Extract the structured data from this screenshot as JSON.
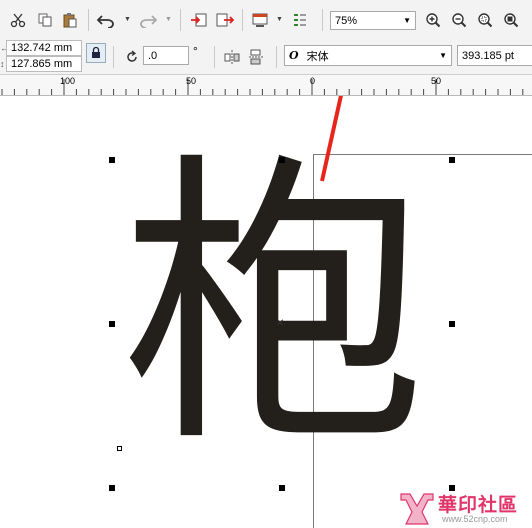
{
  "toolbar": {
    "zoom_value": "75%",
    "zoom_options": [
      "75%"
    ]
  },
  "property_bar": {
    "width_value": "132.742 mm",
    "height_value": "127.865 mm",
    "rotation_value": ".0",
    "degree_symbol": "°",
    "font_name": "宋体",
    "font_size": "393.185 pt"
  },
  "ruler": {
    "ticks": [
      "100",
      "50",
      "0",
      "50"
    ]
  },
  "canvas": {
    "text": "枹"
  },
  "watermark": {
    "brand": "華印社區",
    "url": "www.52cnp.com"
  },
  "colors": {
    "toolbar_bg": "#f3f3f3",
    "text_fill": "#231f1a",
    "annotation_arrow": "#e8251c",
    "watermark_pink": "#e0356b"
  },
  "icons": [
    "scissors-icon",
    "copy-icon",
    "paste-icon",
    "undo-icon",
    "redo-icon",
    "import-icon",
    "export-icon",
    "application-launcher-icon",
    "ruler-options-icon",
    "zoom-in-icon",
    "zoom-out-icon",
    "zoom-to-selection-icon",
    "zoom-to-all-icon",
    "lock-ratio-icon",
    "rotate-icon",
    "mirror-horizontal-icon",
    "mirror-vertical-icon"
  ]
}
